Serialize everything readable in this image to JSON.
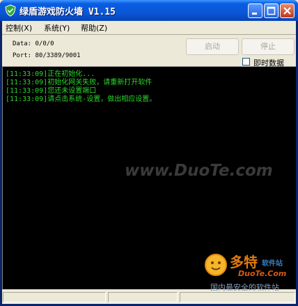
{
  "window": {
    "title": "绿盾游戏防火墙 V1.15"
  },
  "menu": [
    {
      "label": "控制(X)"
    },
    {
      "label": "系统(Y)"
    },
    {
      "label": "帮助(Z)"
    }
  ],
  "info": {
    "data_line": "Data: 0/0/0",
    "port_line": "Port: 80/3389/9001"
  },
  "buttons": {
    "start": "启动",
    "stop": "停止"
  },
  "checkbox": {
    "label": "即时数据",
    "checked": false
  },
  "log": [
    "[11:33:09]正在初始化...",
    "[11:33:09]初始化网关失败，请重新打开软件",
    "[11:33:09]您还未设置端口",
    "[11:33:09]请点击系统-设置，做出相应设置。"
  ],
  "watermark": "www.DuoTe.com",
  "site_mark": {
    "name": "多特",
    "name_suffix": "软件站",
    "domain": "DuoTe.Com",
    "slogan": "国内最安全的软件站"
  },
  "colors": {
    "titlebar": "#0a58d8",
    "log_bg": "#000000",
    "log_text": "#2bd82b"
  }
}
